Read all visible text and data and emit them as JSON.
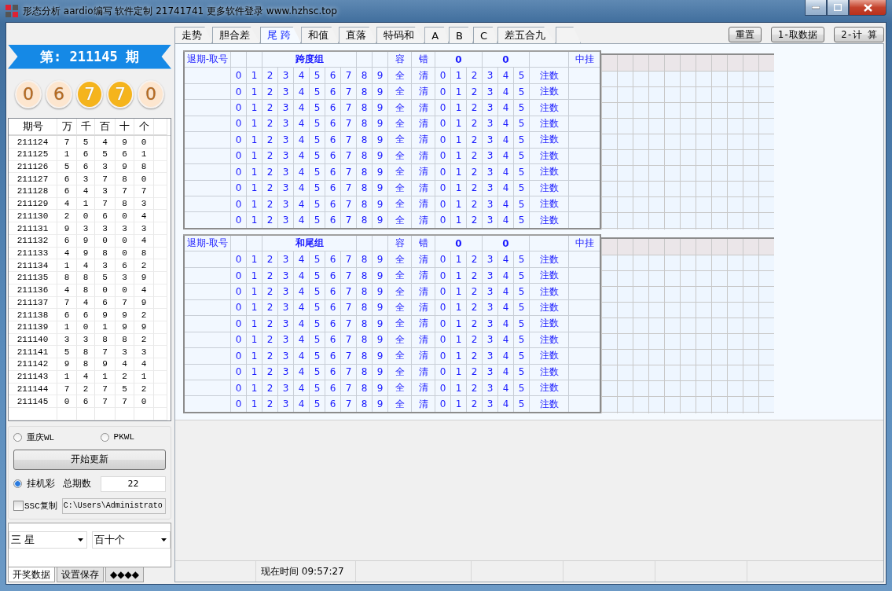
{
  "window": {
    "title": "形态分析 aardio编写 软件定制 21741741  更多软件登录 www.hzhsc.top"
  },
  "draw": {
    "label": "第: 211145  期"
  },
  "balls": [
    {
      "value": "0",
      "highlighted": false
    },
    {
      "value": "6",
      "highlighted": false
    },
    {
      "value": "7",
      "highlighted": true
    },
    {
      "value": "7",
      "highlighted": true
    },
    {
      "value": "0",
      "highlighted": false
    }
  ],
  "history": {
    "columns": [
      "期号",
      "万",
      "千",
      "百",
      "十",
      "个"
    ],
    "rows": [
      [
        "211124",
        "7",
        "5",
        "4",
        "9",
        "0"
      ],
      [
        "211125",
        "1",
        "6",
        "5",
        "6",
        "1"
      ],
      [
        "211126",
        "5",
        "6",
        "3",
        "9",
        "8"
      ],
      [
        "211127",
        "6",
        "3",
        "7",
        "8",
        "0"
      ],
      [
        "211128",
        "6",
        "4",
        "3",
        "7",
        "7"
      ],
      [
        "211129",
        "4",
        "1",
        "7",
        "8",
        "3"
      ],
      [
        "211130",
        "2",
        "0",
        "6",
        "0",
        "4"
      ],
      [
        "211131",
        "9",
        "3",
        "3",
        "3",
        "3"
      ],
      [
        "211132",
        "6",
        "9",
        "0",
        "0",
        "4"
      ],
      [
        "211133",
        "4",
        "9",
        "8",
        "0",
        "8"
      ],
      [
        "211134",
        "1",
        "4",
        "3",
        "6",
        "2"
      ],
      [
        "211135",
        "8",
        "8",
        "5",
        "3",
        "9"
      ],
      [
        "211136",
        "4",
        "8",
        "0",
        "0",
        "4"
      ],
      [
        "211137",
        "7",
        "4",
        "6",
        "7",
        "9"
      ],
      [
        "211138",
        "6",
        "6",
        "9",
        "9",
        "2"
      ],
      [
        "211139",
        "1",
        "0",
        "1",
        "9",
        "9"
      ],
      [
        "211140",
        "3",
        "3",
        "8",
        "8",
        "2"
      ],
      [
        "211141",
        "5",
        "8",
        "7",
        "3",
        "3"
      ],
      [
        "211142",
        "9",
        "8",
        "9",
        "4",
        "4"
      ],
      [
        "211143",
        "1",
        "4",
        "1",
        "2",
        "1"
      ],
      [
        "211144",
        "7",
        "2",
        "7",
        "5",
        "2"
      ],
      [
        "211145",
        "0",
        "6",
        "7",
        "7",
        "0"
      ]
    ]
  },
  "options": {
    "sources": [
      {
        "label": "重庆WL",
        "selected": false
      },
      {
        "label": "PKWL",
        "selected": false
      }
    ],
    "update_button": "开始更新",
    "mode": {
      "label": "挂机彩",
      "selected": true
    },
    "total_label": "总期数",
    "total_value": "22",
    "copy": {
      "label": "SSC复制",
      "checked": false
    },
    "path_value": "C:\\Users\\Administrato"
  },
  "selects": [
    "三 星",
    "百十个"
  ],
  "bottom_tabs": [
    {
      "label": "开奖数据",
      "selected": true
    },
    {
      "label": "设置保存",
      "selected": false
    },
    {
      "label": "◆◆◆◆",
      "selected": false
    }
  ],
  "tabs": [
    {
      "label": "走势",
      "selected": false
    },
    {
      "label": "胆合差",
      "selected": false
    },
    {
      "label": "尾 跨",
      "selected": true
    },
    {
      "label": "和值",
      "selected": false
    },
    {
      "label": "直落",
      "selected": false
    },
    {
      "label": "特码和",
      "selected": false
    },
    {
      "label": "A",
      "selected": false
    },
    {
      "label": "B",
      "selected": false
    },
    {
      "label": "C",
      "selected": false
    },
    {
      "label": "差五合九",
      "selected": false
    }
  ],
  "buttons": [
    "重置",
    "1-取数据",
    "2-计 算"
  ],
  "panels": [
    {
      "header": {
        "period": "退期-取号",
        "group": "跨度组",
        "tolerance": "容",
        "error": "错",
        "set_a": "0",
        "set_b": "0",
        "hit": "中挂"
      },
      "rows": [
        {
          "digits": [
            "0",
            "1",
            "2",
            "3",
            "4",
            "5",
            "6",
            "7",
            "8",
            "9"
          ],
          "all": "全",
          "clear": "清",
          "counts": [
            "0",
            "1",
            "2",
            "3",
            "4",
            "5"
          ],
          "note": "注数"
        },
        {
          "digits": [
            "0",
            "1",
            "2",
            "3",
            "4",
            "5",
            "6",
            "7",
            "8",
            "9"
          ],
          "all": "全",
          "clear": "清",
          "counts": [
            "0",
            "1",
            "2",
            "3",
            "4",
            "5"
          ],
          "note": "注数"
        },
        {
          "digits": [
            "0",
            "1",
            "2",
            "3",
            "4",
            "5",
            "6",
            "7",
            "8",
            "9"
          ],
          "all": "全",
          "clear": "清",
          "counts": [
            "0",
            "1",
            "2",
            "3",
            "4",
            "5"
          ],
          "note": "注数"
        },
        {
          "digits": [
            "0",
            "1",
            "2",
            "3",
            "4",
            "5",
            "6",
            "7",
            "8",
            "9"
          ],
          "all": "全",
          "clear": "清",
          "counts": [
            "0",
            "1",
            "2",
            "3",
            "4",
            "5"
          ],
          "note": "注数"
        },
        {
          "digits": [
            "0",
            "1",
            "2",
            "3",
            "4",
            "5",
            "6",
            "7",
            "8",
            "9"
          ],
          "all": "全",
          "clear": "清",
          "counts": [
            "0",
            "1",
            "2",
            "3",
            "4",
            "5"
          ],
          "note": "注数"
        },
        {
          "digits": [
            "0",
            "1",
            "2",
            "3",
            "4",
            "5",
            "6",
            "7",
            "8",
            "9"
          ],
          "all": "全",
          "clear": "清",
          "counts": [
            "0",
            "1",
            "2",
            "3",
            "4",
            "5"
          ],
          "note": "注数"
        },
        {
          "digits": [
            "0",
            "1",
            "2",
            "3",
            "4",
            "5",
            "6",
            "7",
            "8",
            "9"
          ],
          "all": "全",
          "clear": "清",
          "counts": [
            "0",
            "1",
            "2",
            "3",
            "4",
            "5"
          ],
          "note": "注数"
        },
        {
          "digits": [
            "0",
            "1",
            "2",
            "3",
            "4",
            "5",
            "6",
            "7",
            "8",
            "9"
          ],
          "all": "全",
          "clear": "清",
          "counts": [
            "0",
            "1",
            "2",
            "3",
            "4",
            "5"
          ],
          "note": "注数"
        },
        {
          "digits": [
            "0",
            "1",
            "2",
            "3",
            "4",
            "5",
            "6",
            "7",
            "8",
            "9"
          ],
          "all": "全",
          "clear": "清",
          "counts": [
            "0",
            "1",
            "2",
            "3",
            "4",
            "5"
          ],
          "note": "注数"
        },
        {
          "digits": [
            "0",
            "1",
            "2",
            "3",
            "4",
            "5",
            "6",
            "7",
            "8",
            "9"
          ],
          "all": "全",
          "clear": "清",
          "counts": [
            "0",
            "1",
            "2",
            "3",
            "4",
            "5"
          ],
          "note": "注数"
        }
      ]
    },
    {
      "header": {
        "period": "退期-取号",
        "group": "和尾组",
        "tolerance": "容",
        "error": "错",
        "set_a": "0",
        "set_b": "0",
        "hit": "中挂"
      },
      "rows": [
        {
          "digits": [
            "0",
            "1",
            "2",
            "3",
            "4",
            "5",
            "6",
            "7",
            "8",
            "9"
          ],
          "all": "全",
          "clear": "清",
          "counts": [
            "0",
            "1",
            "2",
            "3",
            "4",
            "5"
          ],
          "note": "注数"
        },
        {
          "digits": [
            "0",
            "1",
            "2",
            "3",
            "4",
            "5",
            "6",
            "7",
            "8",
            "9"
          ],
          "all": "全",
          "clear": "清",
          "counts": [
            "0",
            "1",
            "2",
            "3",
            "4",
            "5"
          ],
          "note": "注数"
        },
        {
          "digits": [
            "0",
            "1",
            "2",
            "3",
            "4",
            "5",
            "6",
            "7",
            "8",
            "9"
          ],
          "all": "全",
          "clear": "清",
          "counts": [
            "0",
            "1",
            "2",
            "3",
            "4",
            "5"
          ],
          "note": "注数"
        },
        {
          "digits": [
            "0",
            "1",
            "2",
            "3",
            "4",
            "5",
            "6",
            "7",
            "8",
            "9"
          ],
          "all": "全",
          "clear": "清",
          "counts": [
            "0",
            "1",
            "2",
            "3",
            "4",
            "5"
          ],
          "note": "注数"
        },
        {
          "digits": [
            "0",
            "1",
            "2",
            "3",
            "4",
            "5",
            "6",
            "7",
            "8",
            "9"
          ],
          "all": "全",
          "clear": "清",
          "counts": [
            "0",
            "1",
            "2",
            "3",
            "4",
            "5"
          ],
          "note": "注数"
        },
        {
          "digits": [
            "0",
            "1",
            "2",
            "3",
            "4",
            "5",
            "6",
            "7",
            "8",
            "9"
          ],
          "all": "全",
          "clear": "清",
          "counts": [
            "0",
            "1",
            "2",
            "3",
            "4",
            "5"
          ],
          "note": "注数"
        },
        {
          "digits": [
            "0",
            "1",
            "2",
            "3",
            "4",
            "5",
            "6",
            "7",
            "8",
            "9"
          ],
          "all": "全",
          "clear": "清",
          "counts": [
            "0",
            "1",
            "2",
            "3",
            "4",
            "5"
          ],
          "note": "注数"
        },
        {
          "digits": [
            "0",
            "1",
            "2",
            "3",
            "4",
            "5",
            "6",
            "7",
            "8",
            "9"
          ],
          "all": "全",
          "clear": "清",
          "counts": [
            "0",
            "1",
            "2",
            "3",
            "4",
            "5"
          ],
          "note": "注数"
        },
        {
          "digits": [
            "0",
            "1",
            "2",
            "3",
            "4",
            "5",
            "6",
            "7",
            "8",
            "9"
          ],
          "all": "全",
          "clear": "清",
          "counts": [
            "0",
            "1",
            "2",
            "3",
            "4",
            "5"
          ],
          "note": "注数"
        },
        {
          "digits": [
            "0",
            "1",
            "2",
            "3",
            "4",
            "5",
            "6",
            "7",
            "8",
            "9"
          ],
          "all": "全",
          "clear": "清",
          "counts": [
            "0",
            "1",
            "2",
            "3",
            "4",
            "5"
          ],
          "note": "注数"
        }
      ]
    }
  ],
  "status_bar": {
    "time": "现在时间 09:57:27"
  }
}
